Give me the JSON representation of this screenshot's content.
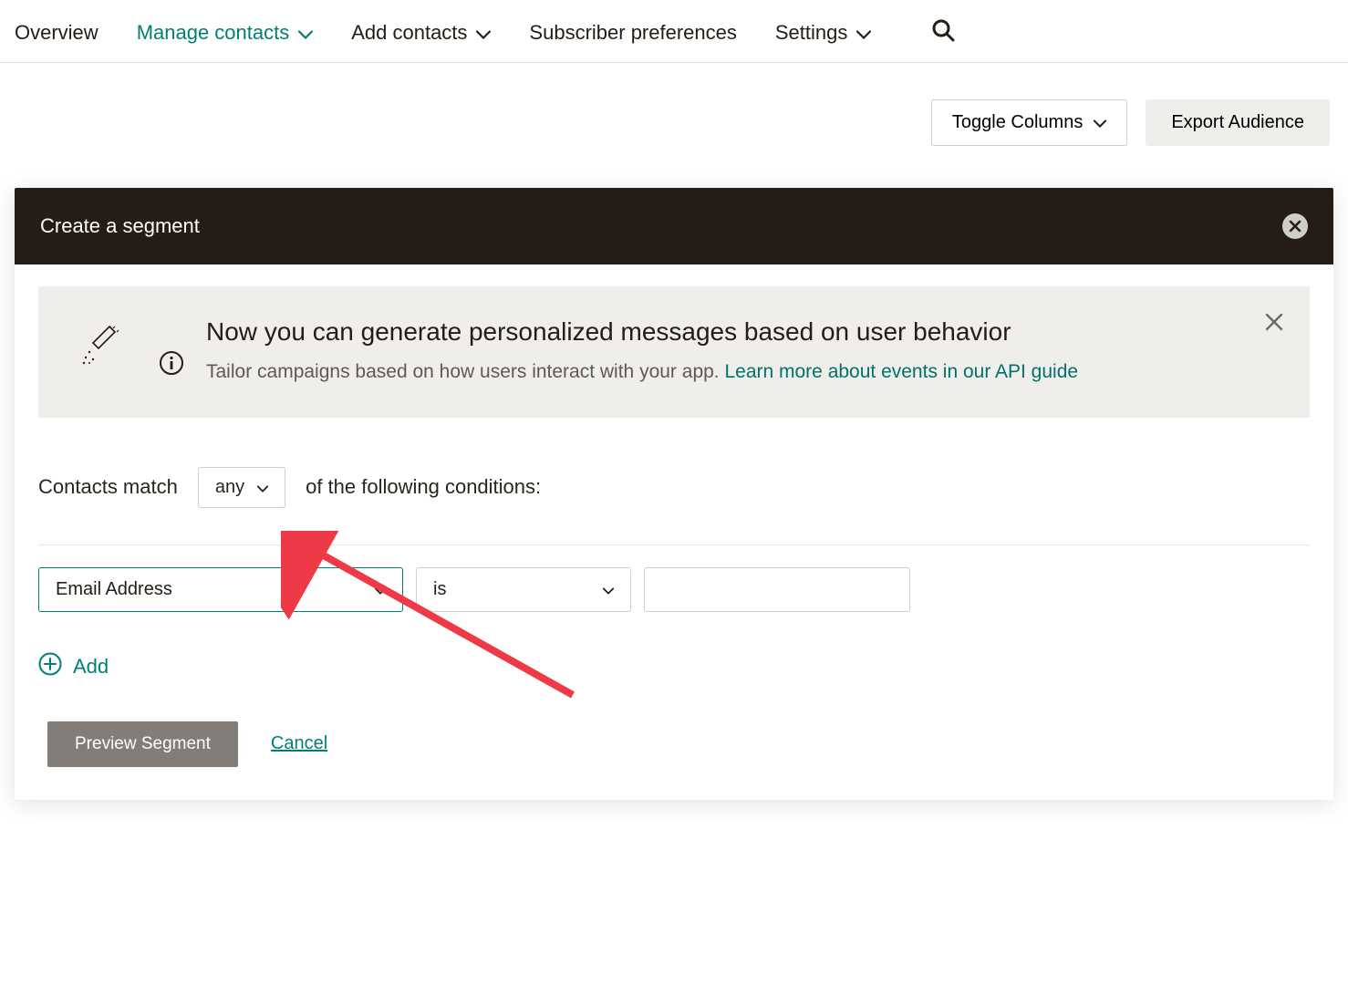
{
  "nav": {
    "items": [
      {
        "label": "Overview"
      },
      {
        "label": "Manage contacts"
      },
      {
        "label": "Add contacts"
      },
      {
        "label": "Subscriber preferences"
      },
      {
        "label": "Settings"
      }
    ]
  },
  "toolbar": {
    "toggle_columns": "Toggle Columns",
    "export_audience": "Export Audience"
  },
  "panel": {
    "title": "Create a segment"
  },
  "banner": {
    "heading": "Now you can generate personalized messages based on user behavior",
    "body_pre": "Tailor campaigns based on how users interact with your app. ",
    "link_text": "Learn more about events in our API guide"
  },
  "match": {
    "pre": "Contacts match",
    "mode": "any",
    "post": "of the following conditions:"
  },
  "condition": {
    "field": "Email Address",
    "operator": "is",
    "value": ""
  },
  "buttons": {
    "add": "Add",
    "preview": "Preview Segment",
    "cancel": "Cancel"
  },
  "colors": {
    "accent": "#008074",
    "dark": "#241c15",
    "arrow": "#ee3a47"
  }
}
